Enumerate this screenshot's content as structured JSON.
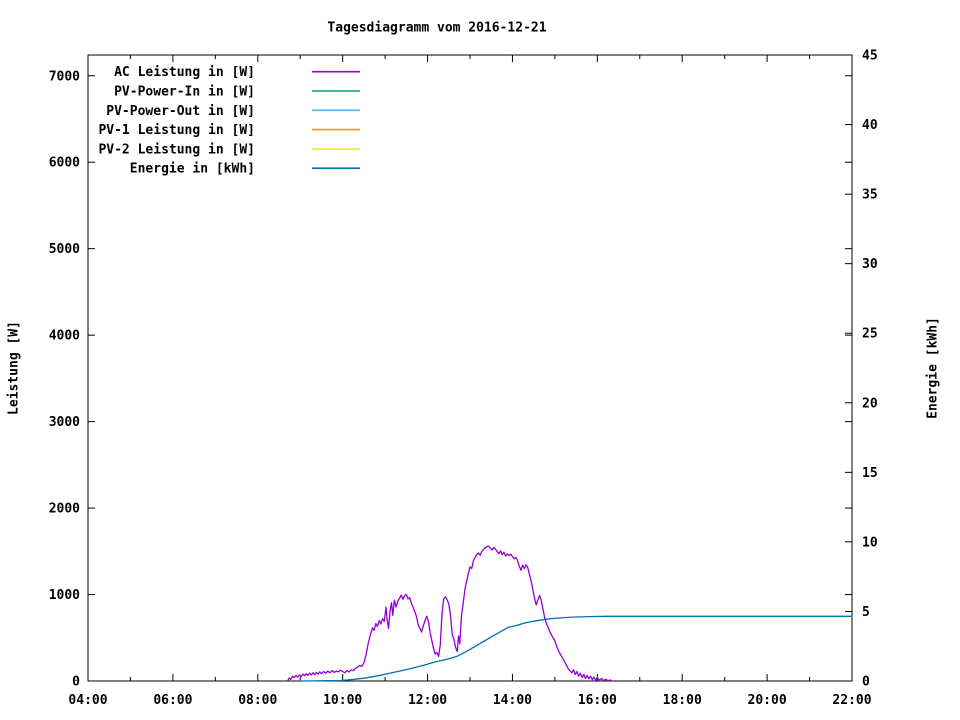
{
  "title": "Tagesdiagramm vom 2016-12-21",
  "chart_data": {
    "type": "line",
    "title": "Tagesdiagramm vom 2016-12-21",
    "grid": false,
    "legend_position": "top-left-inside",
    "x_axis": {
      "label": "",
      "range_hours": [
        4,
        22
      ],
      "major_tick_labels": [
        "04:00",
        "06:00",
        "08:00",
        "10:00",
        "12:00",
        "14:00",
        "16:00",
        "18:00",
        "20:00",
        "22:00"
      ],
      "minor_tick_every_hours": 1
    },
    "y_left": {
      "label": "Leistung [W]",
      "tick_labels": [
        "0",
        "1000",
        "2000",
        "3000",
        "4000",
        "5000",
        "6000",
        "7000"
      ],
      "tick_values": [
        0,
        1000,
        2000,
        3000,
        4000,
        5000,
        6000,
        7000
      ],
      "range": [
        0,
        7240
      ]
    },
    "y_right": {
      "label": "Energie [kWh]",
      "tick_labels": [
        "0",
        "5",
        "10",
        "15",
        "20",
        "25",
        "30",
        "35",
        "40",
        "45"
      ],
      "tick_values": [
        0,
        5,
        10,
        15,
        20,
        25,
        30,
        35,
        40,
        45
      ],
      "range": [
        0,
        45
      ]
    },
    "series": [
      {
        "name": "AC Leistung in [W]",
        "color": "#9400d3",
        "axis": "left",
        "points": [
          [
            8.7,
            0
          ],
          [
            8.74,
            35
          ],
          [
            8.78,
            20
          ],
          [
            8.82,
            55
          ],
          [
            8.86,
            40
          ],
          [
            8.9,
            65
          ],
          [
            8.94,
            45
          ],
          [
            8.98,
            70
          ],
          [
            9.02,
            50
          ],
          [
            9.06,
            80
          ],
          [
            9.1,
            60
          ],
          [
            9.14,
            85
          ],
          [
            9.18,
            65
          ],
          [
            9.22,
            90
          ],
          [
            9.26,
            70
          ],
          [
            9.3,
            95
          ],
          [
            9.34,
            75
          ],
          [
            9.38,
            100
          ],
          [
            9.42,
            80
          ],
          [
            9.46,
            105
          ],
          [
            9.5,
            85
          ],
          [
            9.55,
            110
          ],
          [
            9.6,
            90
          ],
          [
            9.65,
            115
          ],
          [
            9.7,
            95
          ],
          [
            9.75,
            120
          ],
          [
            9.8,
            100
          ],
          [
            9.85,
            115
          ],
          [
            9.9,
            105
          ],
          [
            9.95,
            125
          ],
          [
            10.0,
            110
          ],
          [
            10.05,
            95
          ],
          [
            10.1,
            120
          ],
          [
            10.15,
            105
          ],
          [
            10.2,
            130
          ],
          [
            10.25,
            120
          ],
          [
            10.3,
            145
          ],
          [
            10.35,
            160
          ],
          [
            10.4,
            180
          ],
          [
            10.45,
            170
          ],
          [
            10.5,
            210
          ],
          [
            10.55,
            300
          ],
          [
            10.6,
            430
          ],
          [
            10.65,
            530
          ],
          [
            10.7,
            615
          ],
          [
            10.74,
            585
          ],
          [
            10.78,
            665
          ],
          [
            10.82,
            630
          ],
          [
            10.86,
            700
          ],
          [
            10.9,
            660
          ],
          [
            10.94,
            720
          ],
          [
            10.98,
            690
          ],
          [
            11.02,
            855
          ],
          [
            11.05,
            705
          ],
          [
            11.08,
            610
          ],
          [
            11.12,
            820
          ],
          [
            11.15,
            905
          ],
          [
            11.18,
            760
          ],
          [
            11.22,
            935
          ],
          [
            11.26,
            855
          ],
          [
            11.3,
            925
          ],
          [
            11.34,
            955
          ],
          [
            11.38,
            995
          ],
          [
            11.42,
            945
          ],
          [
            11.46,
            985
          ],
          [
            11.5,
            1000
          ],
          [
            11.54,
            950
          ],
          [
            11.58,
            965
          ],
          [
            11.62,
            900
          ],
          [
            11.66,
            855
          ],
          [
            11.7,
            800
          ],
          [
            11.74,
            745
          ],
          [
            11.78,
            650
          ],
          [
            11.82,
            610
          ],
          [
            11.86,
            565
          ],
          [
            11.9,
            635
          ],
          [
            11.94,
            700
          ],
          [
            11.98,
            750
          ],
          [
            12.02,
            690
          ],
          [
            12.06,
            560
          ],
          [
            12.1,
            470
          ],
          [
            12.14,
            380
          ],
          [
            12.18,
            310
          ],
          [
            12.22,
            330
          ],
          [
            12.26,
            285
          ],
          [
            12.3,
            420
          ],
          [
            12.34,
            780
          ],
          [
            12.38,
            950
          ],
          [
            12.42,
            975
          ],
          [
            12.46,
            940
          ],
          [
            12.5,
            890
          ],
          [
            12.54,
            760
          ],
          [
            12.58,
            545
          ],
          [
            12.62,
            480
          ],
          [
            12.66,
            390
          ],
          [
            12.7,
            340
          ],
          [
            12.73,
            520
          ],
          [
            12.76,
            430
          ],
          [
            12.8,
            760
          ],
          [
            12.84,
            900
          ],
          [
            12.88,
            1060
          ],
          [
            12.92,
            1150
          ],
          [
            12.96,
            1240
          ],
          [
            13.0,
            1320
          ],
          [
            13.04,
            1300
          ],
          [
            13.08,
            1390
          ],
          [
            13.12,
            1430
          ],
          [
            13.16,
            1465
          ],
          [
            13.2,
            1480
          ],
          [
            13.24,
            1455
          ],
          [
            13.28,
            1500
          ],
          [
            13.32,
            1525
          ],
          [
            13.36,
            1540
          ],
          [
            13.4,
            1555
          ],
          [
            13.44,
            1560
          ],
          [
            13.48,
            1535
          ],
          [
            13.52,
            1515
          ],
          [
            13.56,
            1545
          ],
          [
            13.6,
            1525
          ],
          [
            13.64,
            1495
          ],
          [
            13.68,
            1475
          ],
          [
            13.72,
            1505
          ],
          [
            13.76,
            1460
          ],
          [
            13.8,
            1490
          ],
          [
            13.84,
            1445
          ],
          [
            13.88,
            1470
          ],
          [
            13.92,
            1450
          ],
          [
            13.96,
            1465
          ],
          [
            14.0,
            1440
          ],
          [
            14.04,
            1415
          ],
          [
            14.08,
            1430
          ],
          [
            14.12,
            1395
          ],
          [
            14.16,
            1330
          ],
          [
            14.2,
            1280
          ],
          [
            14.24,
            1340
          ],
          [
            14.28,
            1300
          ],
          [
            14.32,
            1345
          ],
          [
            14.36,
            1315
          ],
          [
            14.4,
            1230
          ],
          [
            14.44,
            1160
          ],
          [
            14.48,
            1060
          ],
          [
            14.52,
            960
          ],
          [
            14.56,
            880
          ],
          [
            14.6,
            940
          ],
          [
            14.64,
            990
          ],
          [
            14.68,
            930
          ],
          [
            14.72,
            830
          ],
          [
            14.76,
            730
          ],
          [
            14.8,
            665
          ],
          [
            14.84,
            620
          ],
          [
            14.88,
            570
          ],
          [
            14.92,
            530
          ],
          [
            14.96,
            500
          ],
          [
            15.0,
            465
          ],
          [
            15.05,
            390
          ],
          [
            15.1,
            335
          ],
          [
            15.15,
            290
          ],
          [
            15.2,
            250
          ],
          [
            15.25,
            205
          ],
          [
            15.3,
            155
          ],
          [
            15.35,
            120
          ],
          [
            15.4,
            95
          ],
          [
            15.44,
            130
          ],
          [
            15.48,
            75
          ],
          [
            15.52,
            110
          ],
          [
            15.56,
            55
          ],
          [
            15.6,
            90
          ],
          [
            15.64,
            40
          ],
          [
            15.68,
            75
          ],
          [
            15.72,
            30
          ],
          [
            15.76,
            65
          ],
          [
            15.8,
            25
          ],
          [
            15.84,
            55
          ],
          [
            15.88,
            15
          ],
          [
            15.92,
            45
          ],
          [
            15.96,
            10
          ],
          [
            16.0,
            40
          ],
          [
            16.05,
            8
          ],
          [
            16.1,
            30
          ],
          [
            16.15,
            5
          ],
          [
            16.2,
            20
          ],
          [
            16.25,
            3
          ],
          [
            16.3,
            12
          ],
          [
            16.35,
            0
          ]
        ]
      },
      {
        "name": "PV-Power-In in [W]",
        "color": "#009e73",
        "axis": "left",
        "points": []
      },
      {
        "name": "PV-Power-Out in [W]",
        "color": "#56b4e9",
        "axis": "left",
        "points": []
      },
      {
        "name": "PV-1 Leistung in [W]",
        "color": "#e69f00",
        "axis": "left",
        "points": []
      },
      {
        "name": "PV-2 Leistung in [W]",
        "color": "#f0e442",
        "axis": "left",
        "points": []
      },
      {
        "name": "Energie in [kWh]",
        "color": "#0072b2",
        "axis": "right",
        "points": [
          [
            9.0,
            0
          ],
          [
            9.3,
            0.01
          ],
          [
            9.6,
            0.02
          ],
          [
            9.9,
            0.03
          ],
          [
            10.1,
            0.07
          ],
          [
            10.3,
            0.13
          ],
          [
            10.5,
            0.2
          ],
          [
            10.7,
            0.3
          ],
          [
            10.9,
            0.42
          ],
          [
            11.1,
            0.55
          ],
          [
            11.3,
            0.68
          ],
          [
            11.5,
            0.82
          ],
          [
            11.7,
            0.97
          ],
          [
            11.9,
            1.12
          ],
          [
            12.1,
            1.3
          ],
          [
            12.3,
            1.45
          ],
          [
            12.5,
            1.6
          ],
          [
            12.7,
            1.78
          ],
          [
            12.9,
            2.1
          ],
          [
            13.1,
            2.45
          ],
          [
            13.3,
            2.8
          ],
          [
            13.6,
            3.35
          ],
          [
            13.9,
            3.85
          ],
          [
            14.1,
            4.0
          ],
          [
            14.3,
            4.18
          ],
          [
            14.5,
            4.3
          ],
          [
            14.7,
            4.4
          ],
          [
            14.9,
            4.48
          ],
          [
            15.1,
            4.53
          ],
          [
            15.3,
            4.57
          ],
          [
            15.5,
            4.6
          ],
          [
            15.8,
            4.63
          ],
          [
            16.2,
            4.65
          ],
          [
            17.0,
            4.65
          ],
          [
            18.0,
            4.65
          ],
          [
            19.0,
            4.65
          ],
          [
            20.0,
            4.65
          ],
          [
            21.0,
            4.65
          ],
          [
            22.0,
            4.65
          ]
        ]
      }
    ]
  }
}
